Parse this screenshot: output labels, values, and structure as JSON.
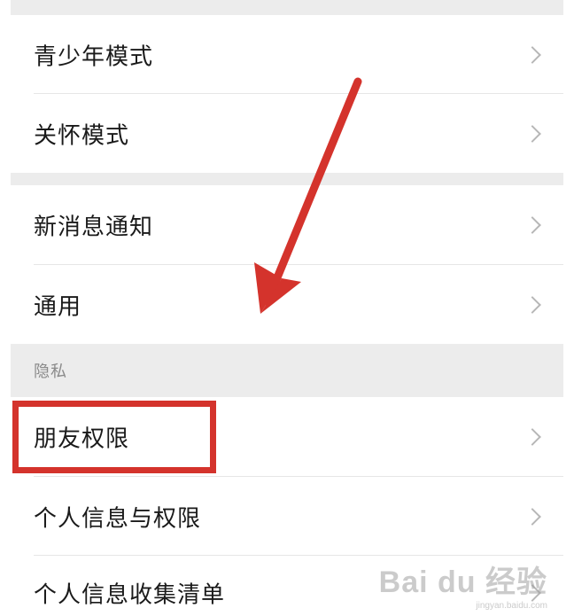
{
  "settings": {
    "items": [
      {
        "label": "青少年模式"
      },
      {
        "label": "关怀模式"
      },
      {
        "label": "新消息通知"
      },
      {
        "label": "通用"
      },
      {
        "label": "朋友权限"
      },
      {
        "label": "个人信息与权限"
      },
      {
        "label": "个人信息收集清单"
      }
    ],
    "privacy_section_title": "隐私"
  },
  "annotation": {
    "color": "#d4332c",
    "arrow_icon": "red-arrow",
    "highlight_target": "朋友权限"
  },
  "watermark": {
    "brand": "Bai du 经验",
    "url": "jingyan.baidu.com"
  }
}
